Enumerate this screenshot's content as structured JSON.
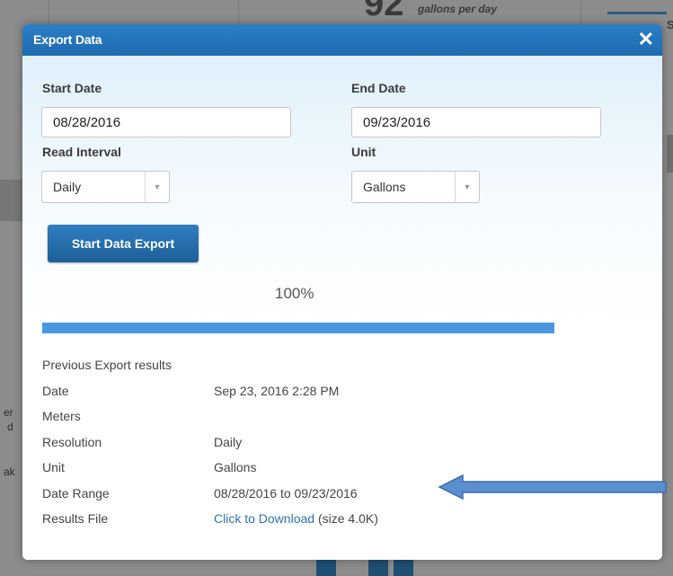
{
  "background": {
    "stat_value": "92",
    "stat_unit": "gallons per day",
    "side_letter": "S",
    "side_text": [
      "er",
      "d",
      "ak"
    ]
  },
  "modal": {
    "title": "Export Data",
    "close_icon": "close-icon",
    "start_date": {
      "label": "Start Date",
      "value": "08/28/2016"
    },
    "end_date": {
      "label": "End Date",
      "value": "09/23/2016"
    },
    "read_interval": {
      "label": "Read Interval",
      "selected": "Daily"
    },
    "unit": {
      "label": "Unit",
      "selected": "Gallons"
    },
    "start_button_label": "Start Data Export",
    "progress": {
      "text": "100%",
      "fraction": 1.0
    },
    "results": {
      "heading": "Previous Export results",
      "rows": [
        {
          "label": "Date",
          "value": "Sep 23, 2016 2:28 PM"
        },
        {
          "label": "Meters",
          "value": ""
        },
        {
          "label": "Resolution",
          "value": "Daily"
        },
        {
          "label": "Unit",
          "value": "Gallons"
        },
        {
          "label": "Date Range",
          "value": "08/28/2016 to 09/23/2016"
        },
        {
          "label": "Results File",
          "link_text": "Click to Download",
          "size_text": "(size 4.0K)"
        }
      ]
    }
  },
  "colors": {
    "header_blue": "#2474bc",
    "button_blue": "#2769a8",
    "progress_blue": "#4a97e0",
    "link_blue": "#2a73b8",
    "annotation_arrow": "#5a8fcf"
  }
}
